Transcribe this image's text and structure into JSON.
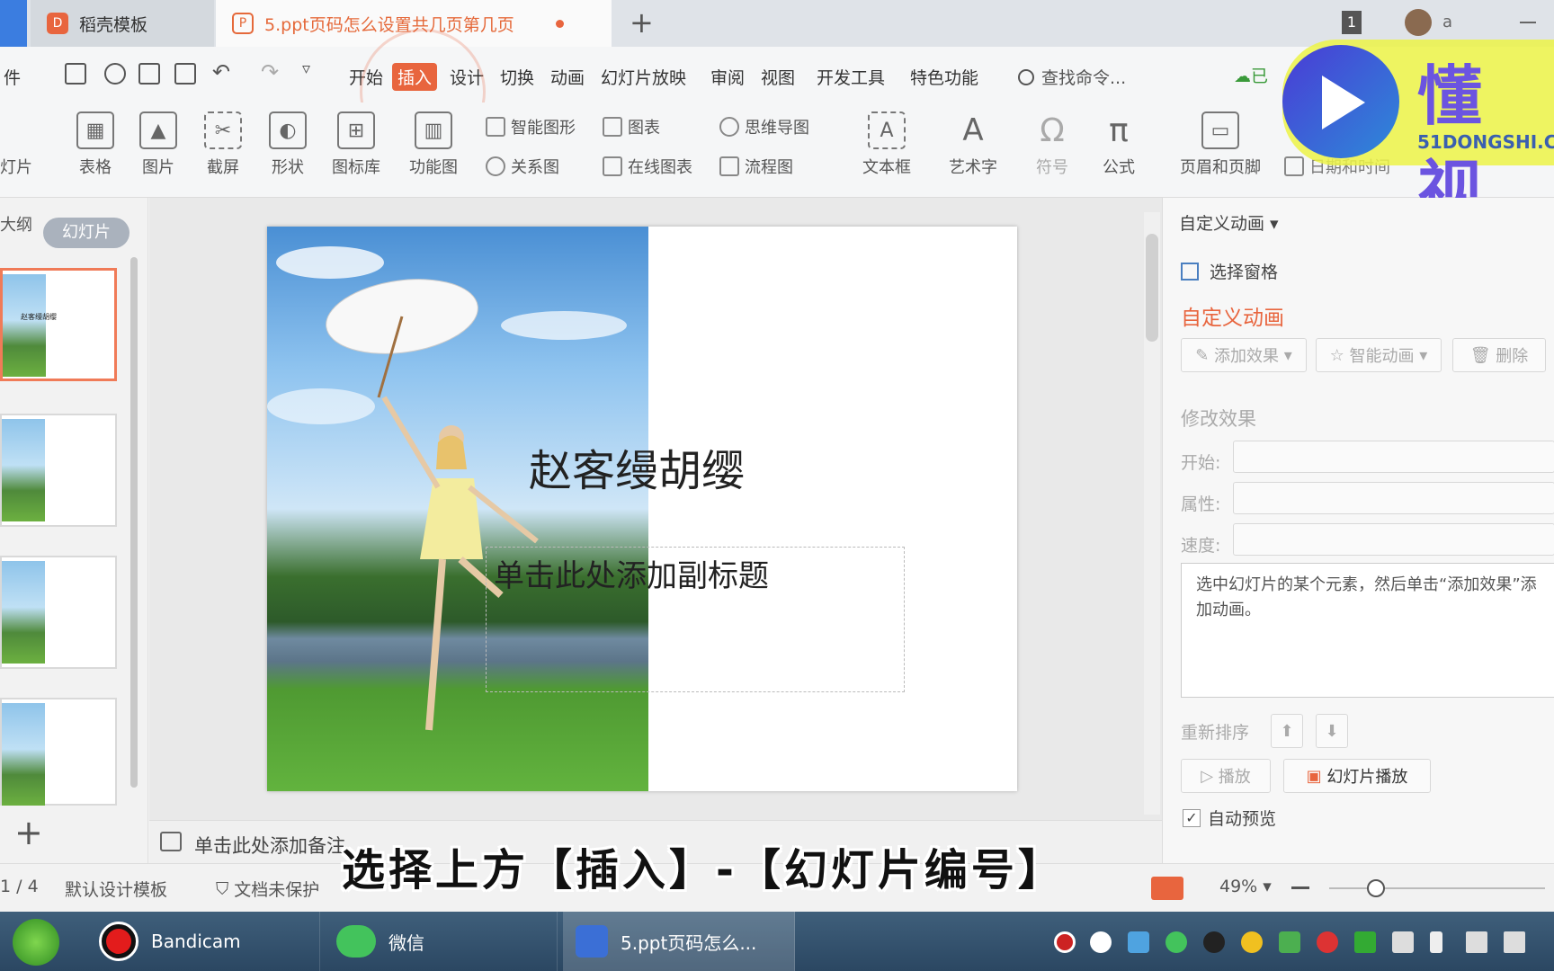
{
  "titlebar": {
    "tabs": [
      {
        "label": "稻壳模板"
      },
      {
        "label": "5.ppt页码怎么设置共几页第几页"
      }
    ],
    "new_tab": "+",
    "window_count": "1",
    "user_initial": "a"
  },
  "menu": {
    "partial": "件",
    "items": [
      "开始",
      "插入",
      "设计",
      "切换",
      "动画",
      "幻灯片放映",
      "审阅",
      "视图",
      "开发工具",
      "特色功能"
    ],
    "search": "查找命令...",
    "sync": "已"
  },
  "ribbon": {
    "partial_left": "灯片",
    "big": [
      "表格",
      "图片",
      "截屏",
      "形状",
      "图标库",
      "功能图"
    ],
    "small_a": [
      "智能图形",
      "关系图"
    ],
    "small_b": [
      "图表",
      "在线图表"
    ],
    "small_c": [
      "思维导图",
      "流程图"
    ],
    "big2": [
      "文本框",
      "艺术字",
      "符号",
      "公式"
    ],
    "headerfooter": "页眉和页脚",
    "datetime": "日期和时间"
  },
  "leftpane": {
    "tab_outline": "大纲",
    "tab_slides": "幻灯片",
    "thumb_title": "赵客缦胡缨",
    "add": "+"
  },
  "slide": {
    "title": "赵客缦胡缨",
    "subtitle": "单击此处添加副标题"
  },
  "notes": {
    "placeholder": "单击此处添加备注"
  },
  "rightpane": {
    "header": "自定义动画",
    "select_pane": "选择窗格",
    "section_title": "自定义动画",
    "add_effect": "添加效果",
    "smart_anim": "智能动画",
    "delete": "删除",
    "modify": "修改效果",
    "start": "开始:",
    "property": "属性:",
    "speed": "速度:",
    "hint": "选中幻灯片的某个元素，然后单击“添加效果”添加动画。",
    "reorder": "重新排序",
    "play": "播放",
    "slideshow": "幻灯片播放",
    "autopreview": "自动预览"
  },
  "status": {
    "page": "1 / 4",
    "template": "默认设计模板",
    "protect": "文档未保护",
    "zoom": "49%"
  },
  "caption": "选择上方【插入】-【幻灯片编号】",
  "watermark": {
    "brand": "懂视",
    "site": "51DONGSHI.C"
  },
  "taskbar": {
    "items": [
      "Bandicam",
      "微信",
      "5.ppt页码怎么..."
    ]
  },
  "colors": {
    "accent": "#e8653e",
    "title_text": "#e5693a",
    "taskbar": "#2b4762"
  }
}
